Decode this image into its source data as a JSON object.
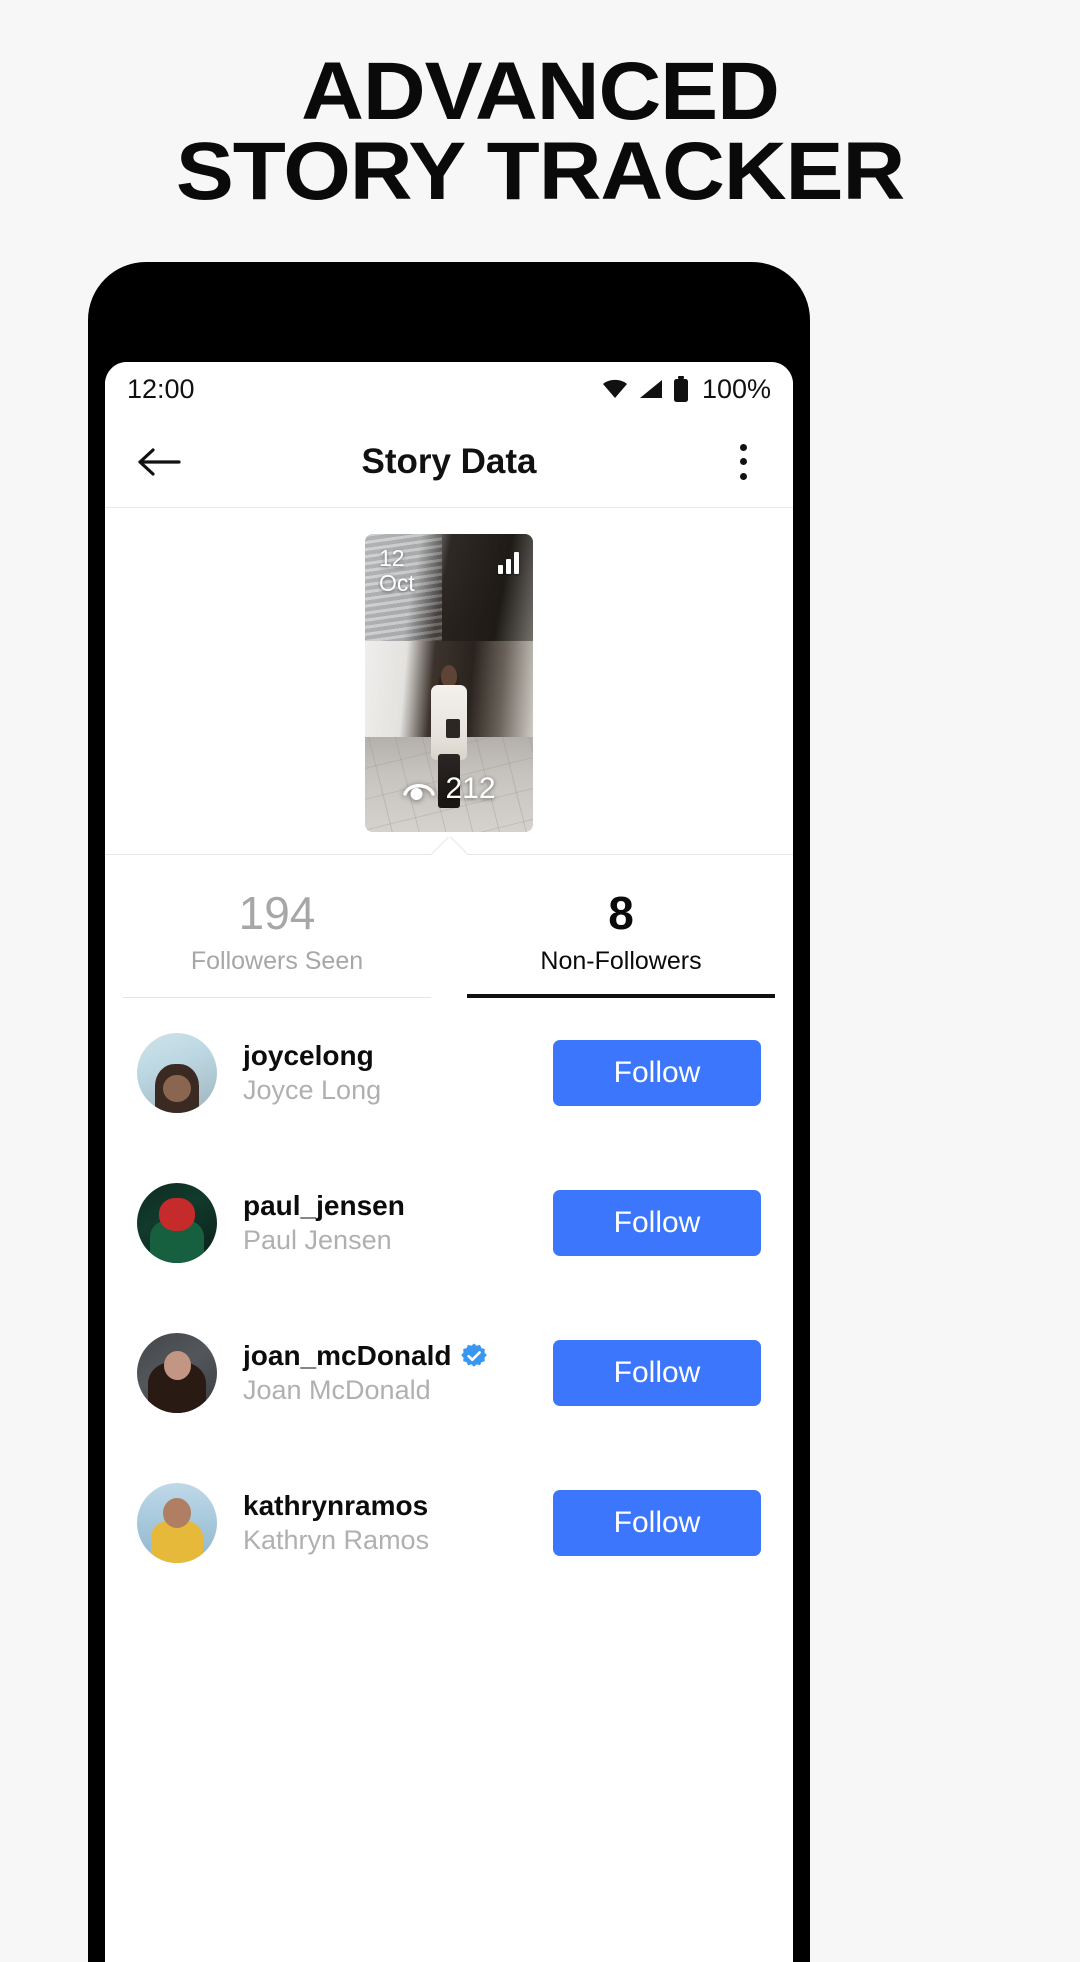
{
  "headline": {
    "line1": "ADVANCED",
    "line2": "STORY TRACKER"
  },
  "statusbar": {
    "time": "12:00",
    "battery": "100%",
    "icons": [
      "wifi-icon",
      "signal-icon",
      "battery-icon"
    ]
  },
  "appbar": {
    "back_icon": "back-arrow-icon",
    "title": "Story Data",
    "overflow_icon": "overflow-menu-icon"
  },
  "story": {
    "date_day": "12",
    "date_month": "Oct",
    "chart_icon": "bar-chart-icon",
    "views_icon": "eye-icon",
    "views": "212"
  },
  "tabs": [
    {
      "value": "194",
      "label": "Followers Seen",
      "active": false
    },
    {
      "value": "8",
      "label": "Non-Followers",
      "active": true
    }
  ],
  "users": [
    {
      "handle": "joycelong",
      "fullname": "Joyce Long",
      "verified": false,
      "action": "Follow"
    },
    {
      "handle": "paul_jensen",
      "fullname": "Paul Jensen",
      "verified": false,
      "action": "Follow"
    },
    {
      "handle": "joan_mcDonald",
      "fullname": "Joan McDonald",
      "verified": true,
      "action": "Follow"
    },
    {
      "handle": "kathrynramos",
      "fullname": "Kathryn Ramos",
      "verified": false,
      "action": "Follow"
    }
  ],
  "colors": {
    "page_background": "#f7f7f7",
    "follow_button": "#3b76fd",
    "verified_badge": "#3897f0",
    "active_text": "#0a0a0a",
    "inactive_text": "#a7a7a7",
    "fullname_text": "#b0b0b0"
  }
}
